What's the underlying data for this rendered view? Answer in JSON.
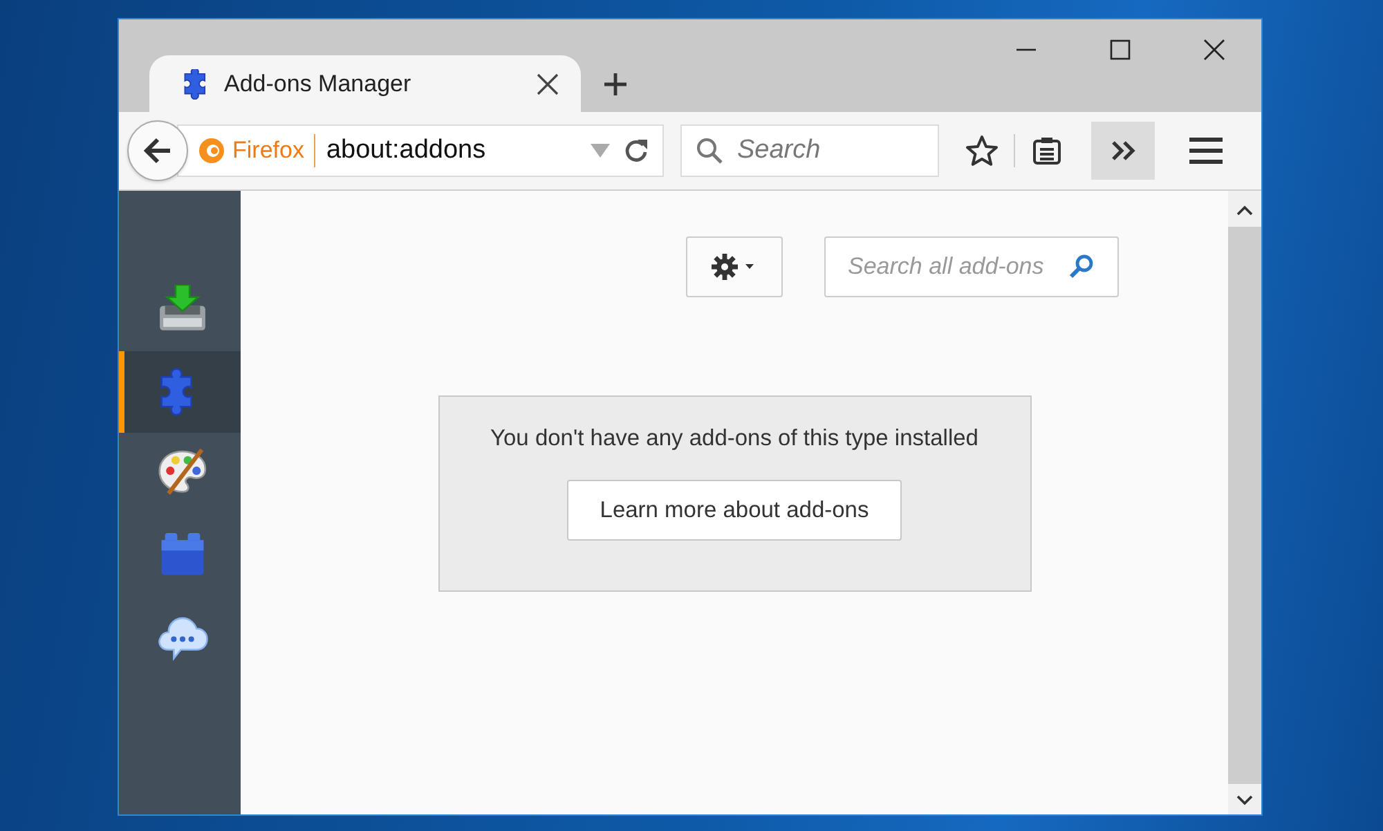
{
  "tabs": [
    {
      "label": "Add-ons Manager",
      "selected": true
    }
  ],
  "address_bar": {
    "identity": "Firefox",
    "url": "about:addons"
  },
  "search": {
    "placeholder": "Search"
  },
  "sidebar": {
    "items": [
      {
        "kind": "get-addons",
        "selected": false
      },
      {
        "kind": "extensions",
        "selected": true
      },
      {
        "kind": "appearance",
        "selected": false
      },
      {
        "kind": "plugins",
        "selected": false
      },
      {
        "kind": "services",
        "selected": false
      }
    ]
  },
  "addon_search": {
    "placeholder": "Search all add-ons"
  },
  "empty_notice": {
    "message": "You don't have any add-ons of this type installed",
    "button": "Learn more about add-ons"
  }
}
